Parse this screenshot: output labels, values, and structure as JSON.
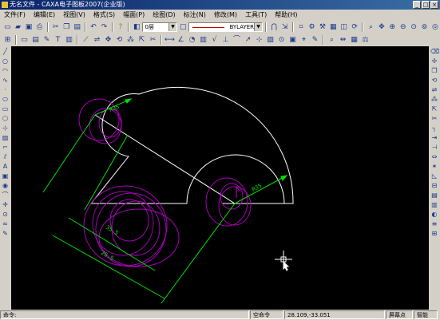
{
  "window": {
    "title": "无名文件 - CAXA电子图板2007(企业版)",
    "controls": [
      "_",
      "□",
      "×"
    ]
  },
  "menu": [
    "文件(F)",
    "编辑(E)",
    "视图(V)",
    "格式(S)",
    "幅面(P)",
    "绘图(D)",
    "标注(N)",
    "修改(M)",
    "工具(T)",
    "帮助(H)"
  ],
  "toolbar": {
    "layer_value": "0层",
    "linetype_value": "BYLAYER",
    "colors": {
      "line_sample": "#c00000"
    }
  },
  "drawing": {
    "dimensions": [
      "R25",
      "R35",
      "35.5",
      "25.5"
    ],
    "colors": {
      "geometry": "#ffffff",
      "dimension": "#00e000",
      "selection": "#b000c0",
      "text": "#00e000"
    }
  },
  "status": {
    "prompt": "命令:",
    "command": "空命令",
    "coords": "28.109,-33.051",
    "snap_mode": "屏幕点",
    "smart": "智能"
  }
}
